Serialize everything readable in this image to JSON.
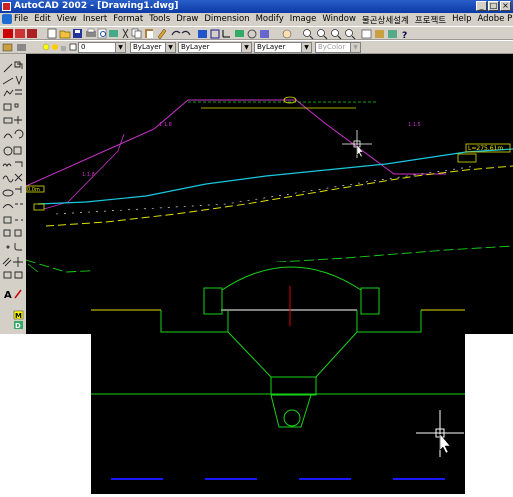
{
  "window": {
    "title": "AutoCAD 2002 - [Drawing1.dwg]",
    "controls": [
      "_",
      "□",
      "×"
    ]
  },
  "menubar": {
    "items": [
      "File",
      "Edit",
      "View",
      "Insert",
      "Format",
      "Tools",
      "Draw",
      "Dimension",
      "Modify",
      "Image",
      "Window",
      "물곤상세설계",
      "프로젝트",
      "Help",
      "Adobe PDF"
    ]
  },
  "properties": {
    "layer": "0",
    "color": "ByLayer",
    "linetype": "ByLayer",
    "lineweight": "ByLayer",
    "plotstyle": "ByColor"
  },
  "drawing": {
    "label_left_slope": "1:1.8",
    "label_right_slope": "1:1.5",
    "label_left_lower_slope": "1:1.8",
    "elevation_tag": "L=275.61m",
    "left_tag": "0.0m"
  },
  "colors": {
    "canvas_bg": "#000000",
    "magenta": "#cc33cc",
    "cyan": "#18c8e0",
    "yellow": "#e0e000",
    "green": "#19d219",
    "red": "#e00000",
    "blue": "#1818ff"
  }
}
